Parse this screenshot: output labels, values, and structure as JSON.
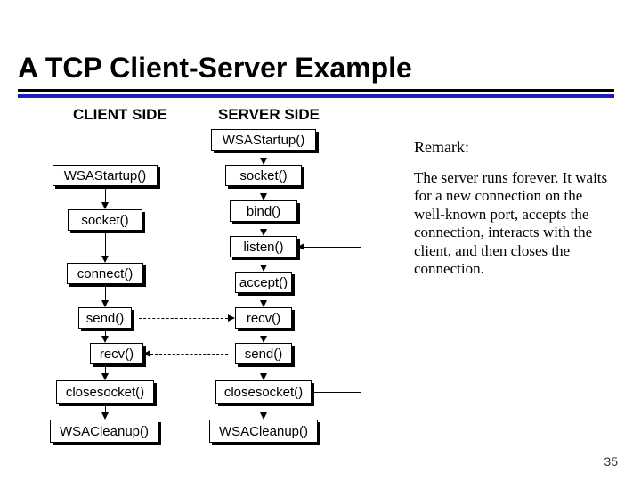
{
  "title": "A TCP Client-Server Example",
  "columns": {
    "client": "CLIENT SIDE",
    "server": "SERVER SIDE"
  },
  "client_boxes": {
    "wsastart": "WSAStartup()",
    "socket": "socket()",
    "connect": "connect()",
    "send": "send()",
    "recv": "recv()",
    "close": "closesocket()",
    "wsacleanup": "WSACleanup()"
  },
  "server_boxes": {
    "wsastart": "WSAStartup()",
    "socket": "socket()",
    "bind": "bind()",
    "listen": "listen()",
    "accept": "accept()",
    "recv": "recv()",
    "send": "send()",
    "close": "closesocket()",
    "wsacleanup": "WSACleanup()"
  },
  "remark": {
    "heading": "Remark:",
    "body": "The server runs forever. It waits for a new connection on the well-known port, accepts the connection, interacts with the client, and then closes the connection."
  },
  "page_number": "35"
}
